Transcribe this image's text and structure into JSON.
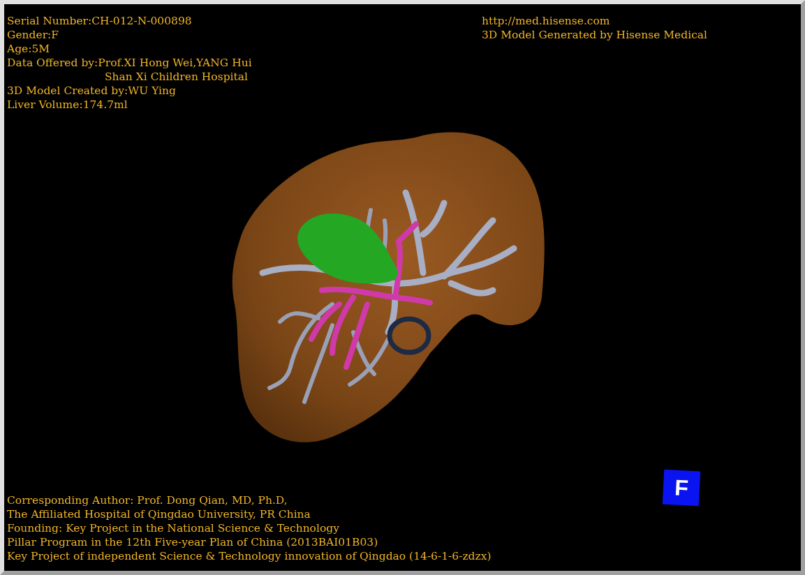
{
  "info_top_left": [
    "Serial Number:CH-012-N-000898",
    "Gender:F",
    "Age:5M"
  ],
  "data_offered": {
    "text": "Data Offered by:Prof.XI Hong Wei,YANG Hui",
    "continuation": "Shan Xi Children Hospital"
  },
  "info_model": [
    "3D Model Created by:WU Ying",
    "Liver Volume:174.7ml"
  ],
  "info_top_right": [
    "http://med.hisense.com",
    "3D Model Generated by Hisense Medical"
  ],
  "info_bottom_left": [
    "Corresponding Author: Prof. Dong Qian, MD, Ph.D,",
    "The Affiliated Hospital of Qingdao University, PR China",
    "Founding: Key Project in the National Science & Technology",
    "Pillar Program in the 12th Five-year Plan of China (2013BAI01B03)",
    "Key Project of independent Science & Technology innovation of Qingdao (14-6-1-6-zdzx)"
  ],
  "orientation_cube": {
    "label": "F"
  }
}
